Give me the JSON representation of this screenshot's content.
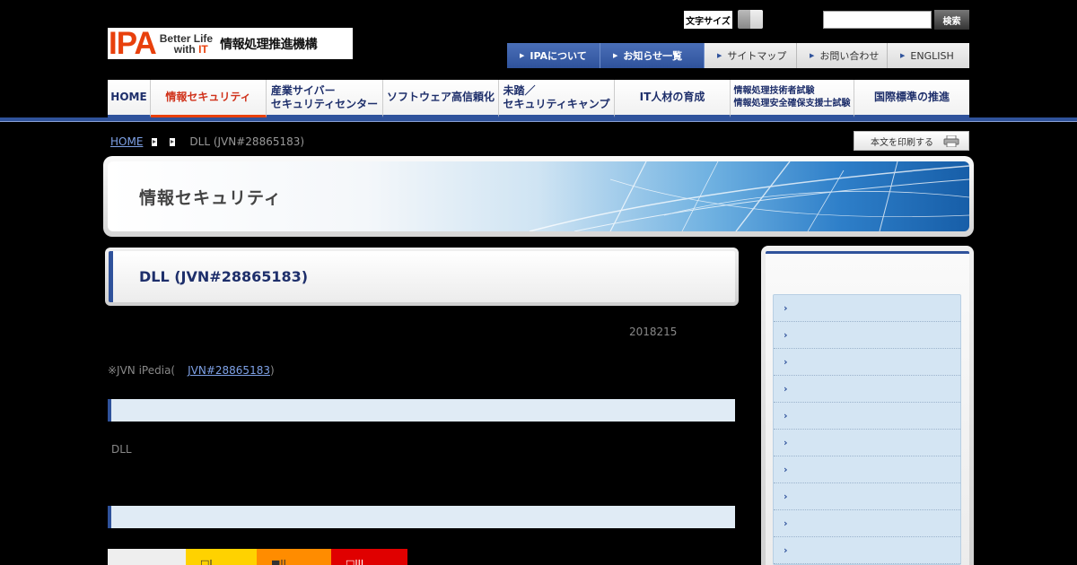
{
  "header": {
    "logo": {
      "ipa": "IPA",
      "tagline_1": "Better Life",
      "tagline_2_prefix": "with ",
      "tagline_2_it": "IT",
      "org_name": "情報処理推進機構"
    },
    "font_size_label": "文字サイズ",
    "search": {
      "value": "",
      "placeholder": "",
      "button_label": "検索"
    },
    "utility_nav": [
      {
        "label": "IPAについて"
      },
      {
        "label": "お知らせ一覧"
      },
      {
        "label": "サイトマップ"
      },
      {
        "label": "お問い合わせ"
      },
      {
        "label": "ENGLISH"
      }
    ]
  },
  "global_nav": [
    {
      "line1": "HOME",
      "line2": ""
    },
    {
      "line1": "情報セキュリティ",
      "line2": ""
    },
    {
      "line1": "産業サイバー",
      "line2": "セキュリティセンター"
    },
    {
      "line1": "ソフトウェア高信頼化",
      "line2": ""
    },
    {
      "line1": "未踏／",
      "line2": "セキュリティキャンプ"
    },
    {
      "line1": "IT人材の育成",
      "line2": ""
    },
    {
      "line1": "情報処理技術者試験",
      "line2": "情報処理安全確保支援士試験"
    },
    {
      "line1": "国際標準の推進",
      "line2": ""
    }
  ],
  "breadcrumb": {
    "home": "HOME",
    "current": "DLL (JVN#28865183)"
  },
  "print_button": "本文を印刷する",
  "banner": {
    "title": "情報セキュリティ"
  },
  "main": {
    "title": "DLL (JVN#28865183)",
    "date": "2018215",
    "jvn_prefix": "※JVN iPedia(",
    "jvn_link": "JVN#28865183",
    "jvn_suffix": ")",
    "dll_text": "DLL",
    "severity": [
      {
        "label": "",
        "color": "#eeeeee",
        "text_color": "#333333"
      },
      {
        "label": "□L",
        "color": "#ffd200",
        "text_color": "#333333"
      },
      {
        "label": "■II",
        "color": "#ff8c00",
        "text_color": "#333333"
      },
      {
        "label": "□III",
        "color": "#e00000",
        "text_color": "#ffffff"
      }
    ]
  },
  "sidebar": {
    "items": [
      {
        "label": ""
      },
      {
        "label": ""
      },
      {
        "label": ""
      },
      {
        "label": ""
      },
      {
        "label": ""
      },
      {
        "label": ""
      },
      {
        "label": ""
      },
      {
        "label": ""
      },
      {
        "label": ""
      },
      {
        "label": ""
      }
    ]
  },
  "colors": {
    "brand_blue": "#2f529b",
    "ipa_orange": "#e8400c",
    "section_bar": "#e0ebf5"
  }
}
